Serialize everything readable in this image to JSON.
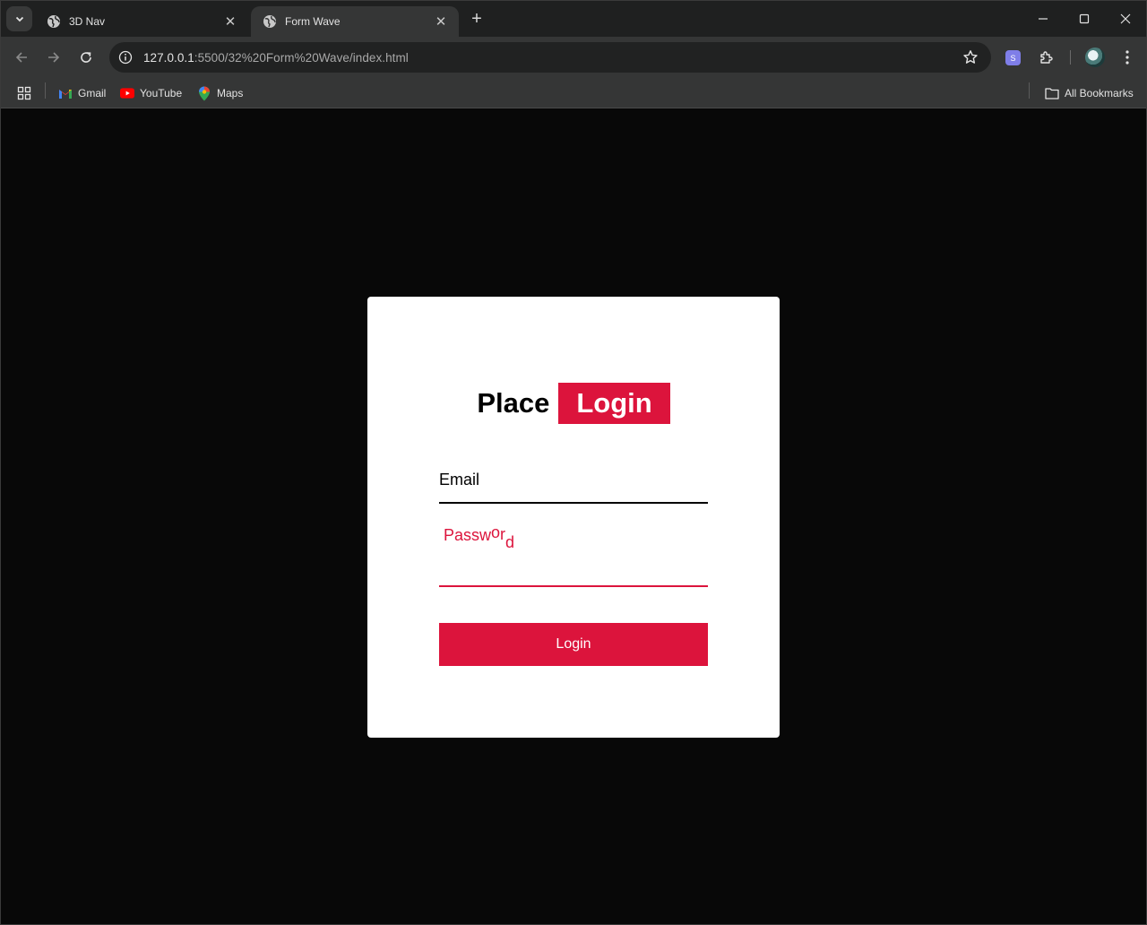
{
  "browser": {
    "tabs": [
      {
        "title": "3D Nav",
        "active": false
      },
      {
        "title": "Form Wave",
        "active": true
      }
    ],
    "url_host": "127.0.0.1",
    "url_rest": ":5500/32%20Form%20Wave/index.html",
    "bookmarks": [
      {
        "label": "Gmail",
        "icon": "gmail-icon"
      },
      {
        "label": "YouTube",
        "icon": "youtube-icon"
      },
      {
        "label": "Maps",
        "icon": "maps-icon"
      }
    ],
    "all_bookmarks_label": "All Bookmarks",
    "extension_badge": "S"
  },
  "form": {
    "heading_prefix": "Place",
    "heading_highlight": "Login",
    "email_label": "Email",
    "password_label_parts": [
      "Passw",
      "o",
      "r",
      "d"
    ],
    "submit_label": "Login"
  },
  "colors": {
    "accent": "#dc143c",
    "page_background": "#080808",
    "card_background": "#ffffff"
  }
}
